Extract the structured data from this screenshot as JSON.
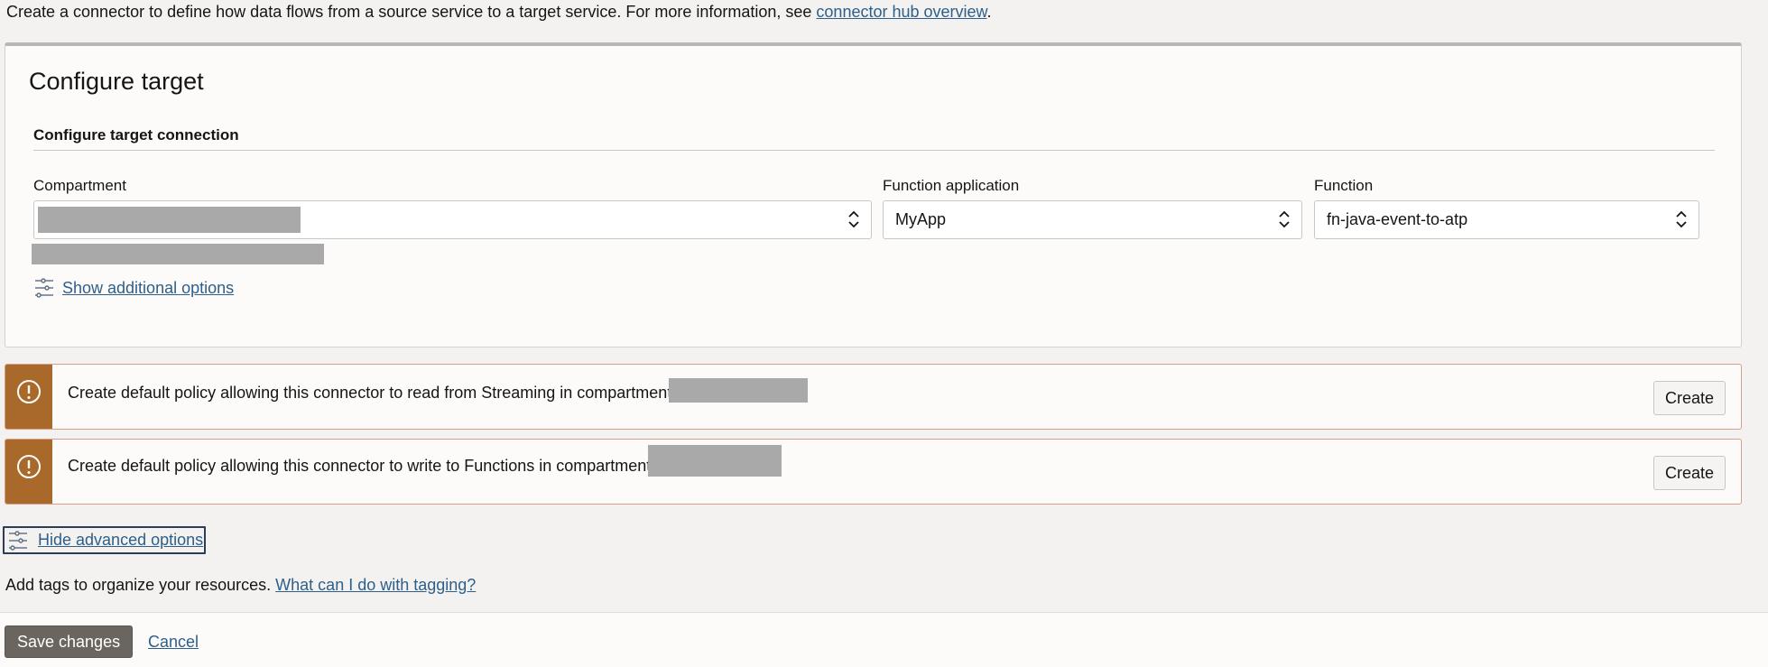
{
  "intro": {
    "text": "Create a connector to define how data flows from a source service to a target service. For more information, see ",
    "link": "connector hub overview",
    "suffix": "."
  },
  "target": {
    "title": "Configure target",
    "section_title": "Configure target connection",
    "compartment": {
      "label": "Compartment",
      "value": ""
    },
    "function_application": {
      "label": "Function application",
      "value": "MyApp"
    },
    "function": {
      "label": "Function",
      "value": "fn-java-event-to-atp"
    },
    "show_additional_options": "Show additional options"
  },
  "policies": [
    {
      "message": "Create default policy allowing this connector to read from Streaming in compartment",
      "button": "Create"
    },
    {
      "message": "Create default policy allowing this connector to write to Functions in compartment",
      "button": "Create"
    }
  ],
  "hide_advanced_options": "Hide advanced options",
  "tags": {
    "text": "Add tags to organize your resources. ",
    "link": "What can I do with tagging?"
  },
  "footer": {
    "save": "Save changes",
    "cancel": "Cancel"
  },
  "colors": {
    "warning": "#a8692b",
    "link": "#2e5f8a",
    "primary_button": "#6b6560"
  },
  "icons": {
    "selector": "chevron-up-down-icon",
    "options": "sliders-icon",
    "warning": "exclamation-circle-icon"
  }
}
